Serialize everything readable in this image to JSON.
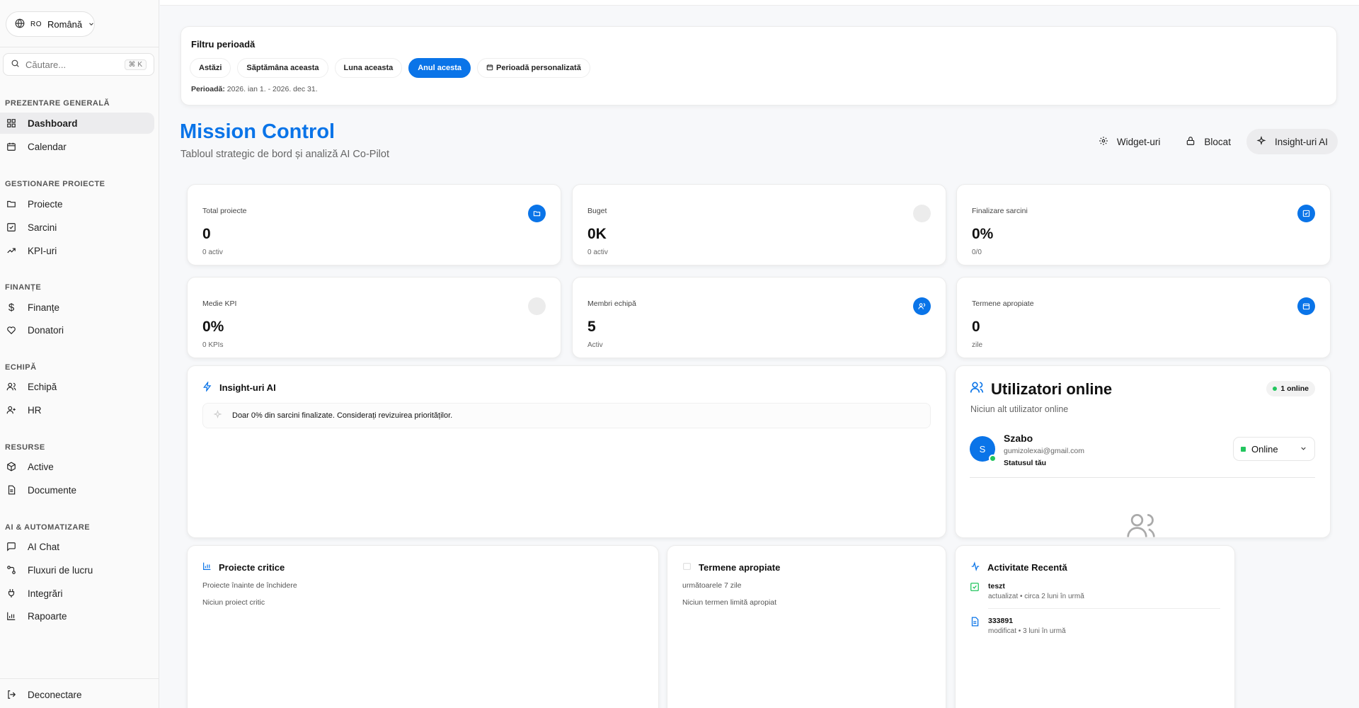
{
  "sidebar": {
    "language": {
      "code": "RO",
      "label": "Română"
    },
    "search": {
      "placeholder": "Căutare...",
      "shortcut": "⌘ K"
    },
    "sections": [
      {
        "title": "PREZENTARE GENERALĂ",
        "items": [
          {
            "label": "Dashboard",
            "icon": "grid-icon",
            "active": true
          },
          {
            "label": "Calendar",
            "icon": "calendar-icon"
          }
        ]
      },
      {
        "title": "GESTIONARE PROIECTE",
        "items": [
          {
            "label": "Proiecte",
            "icon": "folder-icon"
          },
          {
            "label": "Sarcini",
            "icon": "checkbox-icon"
          },
          {
            "label": "KPI-uri",
            "icon": "trend-up-icon"
          }
        ]
      },
      {
        "title": "FINANȚE",
        "items": [
          {
            "label": "Finanțe",
            "icon": "dollar-icon"
          },
          {
            "label": "Donatori",
            "icon": "heart-icon"
          }
        ]
      },
      {
        "title": "ECHIPĂ",
        "items": [
          {
            "label": "Echipă",
            "icon": "users-icon"
          },
          {
            "label": "HR",
            "icon": "user-plus-icon"
          }
        ]
      },
      {
        "title": "RESURSE",
        "items": [
          {
            "label": "Active",
            "icon": "box-icon"
          },
          {
            "label": "Documente",
            "icon": "document-icon"
          }
        ]
      },
      {
        "title": "AI & AUTOMATIZARE",
        "items": [
          {
            "label": "AI Chat",
            "icon": "chat-icon"
          },
          {
            "label": "Fluxuri de lucru",
            "icon": "workflow-icon"
          },
          {
            "label": "Integrări",
            "icon": "plug-icon"
          },
          {
            "label": "Rapoarte",
            "icon": "bar-chart-icon"
          }
        ]
      }
    ],
    "logout": "Deconectare"
  },
  "filter": {
    "title": "Filtru perioadă",
    "chips": [
      {
        "label": "Astăzi",
        "active": false
      },
      {
        "label": "Săptămâna aceasta",
        "active": false
      },
      {
        "label": "Luna aceasta",
        "active": false
      },
      {
        "label": "Anul acesta",
        "active": true
      },
      {
        "label": "Perioadă personalizată",
        "active": false
      }
    ],
    "period_label": "Perioadă:",
    "period_value": "2026. ian 1. - 2026. dec 31."
  },
  "header": {
    "title": "Mission Control",
    "subtitle": "Tabloul strategic de bord și analiză AI Co-Pilot",
    "widgets": "Widget-uri",
    "locked": "Blocat",
    "ai": "Insight-uri AI"
  },
  "stats": [
    {
      "label": "Total proiecte",
      "value": "0",
      "sub": "0 activ",
      "icon": "folder-icon",
      "color": "#0a74e8"
    },
    {
      "label": "Buget",
      "value": "0K",
      "sub": "0 activ",
      "icon": "dollar-icon",
      "color": "#ececec"
    },
    {
      "label": "Finalizare sarcini",
      "value": "0%",
      "sub": "0/0",
      "icon": "checkbox-icon",
      "color": "#0a74e8"
    },
    {
      "label": "Medie KPI",
      "value": "0%",
      "sub": "0 KPIs",
      "icon": "target-icon",
      "color": "#ececec"
    },
    {
      "label": "Membri echipă",
      "value": "5",
      "sub": "Activ",
      "icon": "users-icon",
      "color": "#0a74e8"
    },
    {
      "label": "Termene apropiate",
      "value": "0",
      "sub": "zile",
      "icon": "calendar-icon",
      "color": "#0a74e8"
    }
  ],
  "insights": {
    "title": "Insight-uri AI",
    "message": "Doar 0% din sarcini finalizate. Considerați revizuirea priorităților."
  },
  "online": {
    "title": "Utilizatori online",
    "subtitle": "Niciun alt utilizator online",
    "pill": "1 online",
    "user": {
      "initial": "S",
      "name": "Szabo",
      "email": "gumizolexai@gmail.com",
      "status_label": "Statusul tău"
    },
    "status": "Online"
  },
  "critical": {
    "title": "Proiecte critice",
    "subtitle": "Proiecte înainte de închidere",
    "empty": "Niciun proiect critic"
  },
  "deadlines": {
    "title": "Termene apropiate",
    "subtitle": "următoarele 7 zile",
    "empty": "Niciun termen limită apropiat"
  },
  "activity": {
    "title": "Activitate Recentă",
    "items": [
      {
        "name": "teszt",
        "meta": "actualizat • circa 2 luni în urmă"
      },
      {
        "name": "333891",
        "meta": "modificat • 3 luni în urmă"
      }
    ]
  }
}
